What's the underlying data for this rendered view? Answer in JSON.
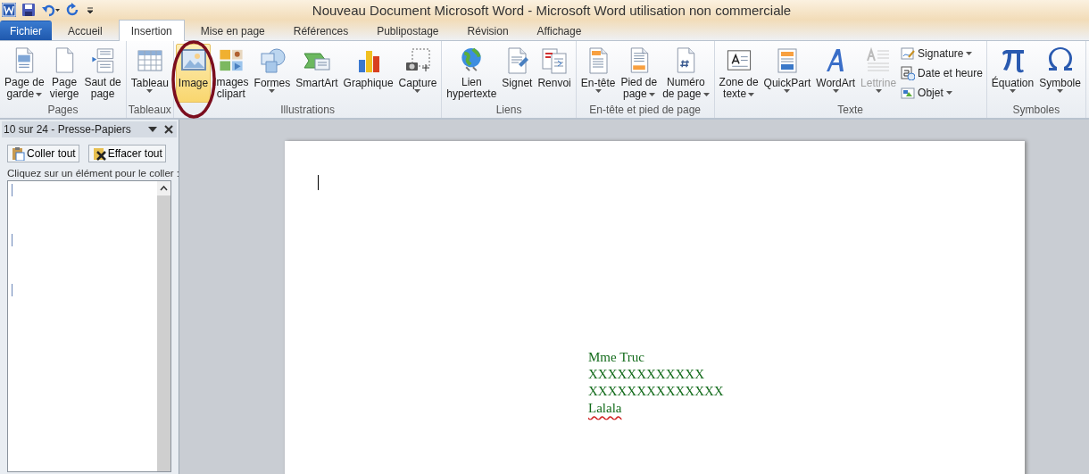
{
  "window": {
    "title": "Nouveau Document Microsoft Word  -  Microsoft Word utilisation non commerciale"
  },
  "tabs": [
    {
      "label": "Fichier",
      "kind": "file",
      "selected": false
    },
    {
      "label": "Accueil",
      "kind": "tab",
      "selected": false
    },
    {
      "label": "Insertion",
      "kind": "tab",
      "selected": true
    },
    {
      "label": "Mise en page",
      "kind": "tab",
      "selected": false
    },
    {
      "label": "Références",
      "kind": "tab",
      "selected": false
    },
    {
      "label": "Publipostage",
      "kind": "tab",
      "selected": false
    },
    {
      "label": "Révision",
      "kind": "tab",
      "selected": false
    },
    {
      "label": "Affichage",
      "kind": "tab",
      "selected": false
    }
  ],
  "ribbon": {
    "groups": [
      {
        "label": "Pages",
        "buttons": [
          {
            "kind": "large",
            "lines": [
              "Page de",
              "garde"
            ],
            "dropdown": true,
            "highlighted": false,
            "disabled": false
          },
          {
            "kind": "large",
            "lines": [
              "Page",
              "vierge"
            ],
            "dropdown": false,
            "highlighted": false,
            "disabled": false
          },
          {
            "kind": "large",
            "lines": [
              "Saut de",
              "page"
            ],
            "dropdown": false,
            "highlighted": false,
            "disabled": false
          }
        ]
      },
      {
        "label": "Tableaux",
        "buttons": [
          {
            "kind": "large",
            "lines": [
              "Tableau"
            ],
            "dropdown": true,
            "highlighted": false,
            "disabled": false
          }
        ]
      },
      {
        "label": "Illustrations",
        "buttons": [
          {
            "kind": "large",
            "lines": [
              "Image"
            ],
            "dropdown": false,
            "highlighted": true,
            "disabled": false
          },
          {
            "kind": "large",
            "lines": [
              "Images",
              "clipart"
            ],
            "dropdown": false,
            "highlighted": false,
            "disabled": false
          },
          {
            "kind": "large",
            "lines": [
              "Formes"
            ],
            "dropdown": true,
            "highlighted": false,
            "disabled": false
          },
          {
            "kind": "large",
            "lines": [
              "SmartArt"
            ],
            "dropdown": false,
            "highlighted": false,
            "disabled": false
          },
          {
            "kind": "large",
            "lines": [
              "Graphique"
            ],
            "dropdown": false,
            "highlighted": false,
            "disabled": false
          },
          {
            "kind": "large",
            "lines": [
              "Capture"
            ],
            "dropdown": true,
            "highlighted": false,
            "disabled": false
          }
        ]
      },
      {
        "label": "Liens",
        "buttons": [
          {
            "kind": "large",
            "lines": [
              "Lien",
              "hypertexte"
            ],
            "dropdown": false,
            "highlighted": false,
            "disabled": false
          },
          {
            "kind": "large",
            "lines": [
              "Signet"
            ],
            "dropdown": false,
            "highlighted": false,
            "disabled": false
          },
          {
            "kind": "large",
            "lines": [
              "Renvoi"
            ],
            "dropdown": false,
            "highlighted": false,
            "disabled": false
          }
        ]
      },
      {
        "label": "En-tête et pied de page",
        "buttons": [
          {
            "kind": "large",
            "lines": [
              "En-tête"
            ],
            "dropdown": true,
            "highlighted": false,
            "disabled": false
          },
          {
            "kind": "large",
            "lines": [
              "Pied de",
              "page"
            ],
            "dropdown": true,
            "highlighted": false,
            "disabled": false
          },
          {
            "kind": "large",
            "lines": [
              "Numéro",
              "de page"
            ],
            "dropdown": true,
            "highlighted": false,
            "disabled": false
          }
        ]
      },
      {
        "label": "Texte",
        "buttons": [
          {
            "kind": "large",
            "lines": [
              "Zone de",
              "texte"
            ],
            "dropdown": true,
            "highlighted": false,
            "disabled": false
          },
          {
            "kind": "large",
            "lines": [
              "QuickPart"
            ],
            "dropdown": true,
            "highlighted": false,
            "disabled": false
          },
          {
            "kind": "large",
            "lines": [
              "WordArt"
            ],
            "dropdown": true,
            "highlighted": false,
            "disabled": false
          },
          {
            "kind": "large",
            "lines": [
              "Lettrine"
            ],
            "dropdown": true,
            "highlighted": false,
            "disabled": true
          },
          {
            "kind": "small",
            "lines": [
              "Signature"
            ],
            "dropdown": true,
            "highlighted": false,
            "disabled": false
          },
          {
            "kind": "small",
            "lines": [
              "Date et heure"
            ],
            "dropdown": false,
            "highlighted": false,
            "disabled": false
          },
          {
            "kind": "small",
            "lines": [
              "Objet"
            ],
            "dropdown": true,
            "highlighted": false,
            "disabled": false
          }
        ]
      },
      {
        "label": "Symboles",
        "buttons": [
          {
            "kind": "large",
            "lines": [
              "Équation"
            ],
            "dropdown": true,
            "highlighted": false,
            "disabled": false
          },
          {
            "kind": "large",
            "lines": [
              "Symbole"
            ],
            "dropdown": true,
            "highlighted": false,
            "disabled": false
          }
        ]
      }
    ]
  },
  "clipboard_pane": {
    "title": "10 sur 24 - Presse-Papiers",
    "buttons": [
      "Coller tout",
      "Effacer tout"
    ],
    "hint": "Cliquez sur un élément pour le coller :",
    "items": [
      {
        "kind": "item"
      },
      {
        "kind": "item"
      },
      {
        "kind": "item"
      }
    ]
  },
  "document": {
    "paragraphs": [
      {
        "text": "Mme Truc",
        "misspelled": false
      },
      {
        "text": "XXXXXXXXXXXX",
        "misspelled": false
      },
      {
        "text": "XXXXXXXXXXXXXX",
        "misspelled": false
      },
      {
        "text": "Lalala",
        "misspelled": true
      }
    ]
  }
}
